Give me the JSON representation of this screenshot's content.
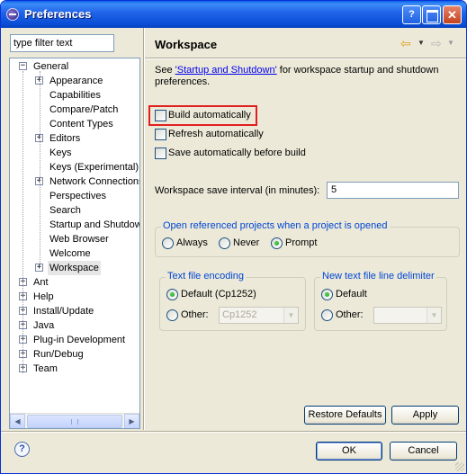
{
  "window": {
    "title": "Preferences"
  },
  "filter": {
    "placeholder": "type filter text",
    "value": "type filter text"
  },
  "tree": {
    "general": "General",
    "general_children": [
      {
        "label": "Appearance",
        "expandable": true
      },
      {
        "label": "Capabilities",
        "expandable": false
      },
      {
        "label": "Compare/Patch",
        "expandable": false
      },
      {
        "label": "Content Types",
        "expandable": false
      },
      {
        "label": "Editors",
        "expandable": true
      },
      {
        "label": "Keys",
        "expandable": false
      },
      {
        "label": "Keys (Experimental)",
        "expandable": false
      },
      {
        "label": "Network Connections",
        "expandable": true
      },
      {
        "label": "Perspectives",
        "expandable": false
      },
      {
        "label": "Search",
        "expandable": false
      },
      {
        "label": "Startup and Shutdown",
        "expandable": false
      },
      {
        "label": "Web Browser",
        "expandable": false
      },
      {
        "label": "Welcome",
        "expandable": false
      },
      {
        "label": "Workspace",
        "expandable": true,
        "selected": true
      }
    ],
    "top_level": [
      {
        "label": "Ant"
      },
      {
        "label": "Help"
      },
      {
        "label": "Install/Update"
      },
      {
        "label": "Java"
      },
      {
        "label": "Plug-in Development"
      },
      {
        "label": "Run/Debug"
      },
      {
        "label": "Team"
      }
    ]
  },
  "page": {
    "title": "Workspace",
    "intro_prefix": "See ",
    "intro_link": "'Startup and Shutdown'",
    "intro_suffix": " for workspace startup and shutdown preferences."
  },
  "options": {
    "build_automatically": "Build automatically",
    "refresh_automatically": "Refresh automatically",
    "save_before_build": "Save automatically before build"
  },
  "interval": {
    "label": "Workspace save interval (in minutes):",
    "value": "5"
  },
  "open_projects": {
    "title": "Open referenced projects when a project is opened",
    "always": "Always",
    "never": "Never",
    "prompt": "Prompt",
    "selected": "Prompt"
  },
  "encoding": {
    "title": "Text file encoding",
    "default_label": "Default (Cp1252)",
    "other_label": "Other:",
    "other_value": "Cp1252"
  },
  "line_delimiter": {
    "title": "New text file line delimiter",
    "default_label": "Default",
    "other_label": "Other:",
    "other_value": ""
  },
  "buttons": {
    "restore_defaults": "Restore Defaults",
    "apply": "Apply",
    "ok": "OK",
    "cancel": "Cancel"
  },
  "colors": {
    "title_bar": "#2062e8",
    "highlight_box": "#e02020",
    "group_title": "#0046d5",
    "link": "#0000ee"
  }
}
